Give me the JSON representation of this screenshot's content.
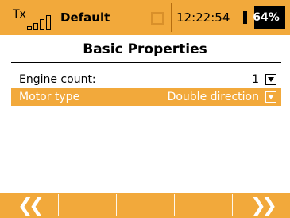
{
  "status": {
    "tx_label": "Tx",
    "model_name": "Default",
    "clock": "12:22:54",
    "battery_percent": "64%",
    "battery_level": 0.64,
    "signal_bars": 4
  },
  "page": {
    "title": "Basic Properties"
  },
  "rows": [
    {
      "label": "Engine count:",
      "value": "1",
      "selected": false,
      "icon": "dropdown-icon"
    },
    {
      "label": "Motor type",
      "value": "Double direction",
      "selected": true,
      "icon": "dropdown-icon"
    }
  ],
  "navigation": {
    "prev_label": "❮❮",
    "next_label": "❯❯",
    "prev_icon": "double-chevron-left-icon",
    "next_icon": "double-chevron-right-icon"
  },
  "colors": {
    "accent": "#f2a93b",
    "text": "#000000",
    "highlight_text": "#ffffff"
  }
}
